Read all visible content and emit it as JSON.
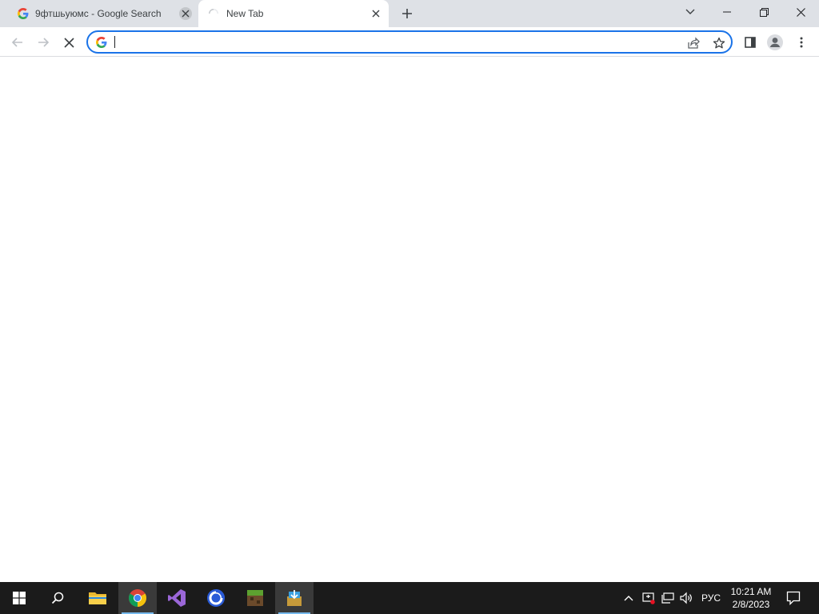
{
  "browser": {
    "tabs": [
      {
        "title": "9фтшьуюмс - Google Search",
        "favicon": "google-g-icon",
        "active": false
      },
      {
        "title": "New Tab",
        "favicon": "loading-spinner-icon",
        "active": true
      }
    ],
    "omnibox": {
      "value": "",
      "placeholder": ""
    },
    "accent": "#1a73e8"
  },
  "taskbar": {
    "apps": [
      "windows-start-icon",
      "search-icon",
      "file-explorer-icon",
      "chrome-icon",
      "visual-studio-icon",
      "app-ring-icon",
      "minecraft-icon",
      "installer-icon"
    ],
    "language": "РУС",
    "time": "10:21 AM",
    "date": "2/8/2023"
  }
}
